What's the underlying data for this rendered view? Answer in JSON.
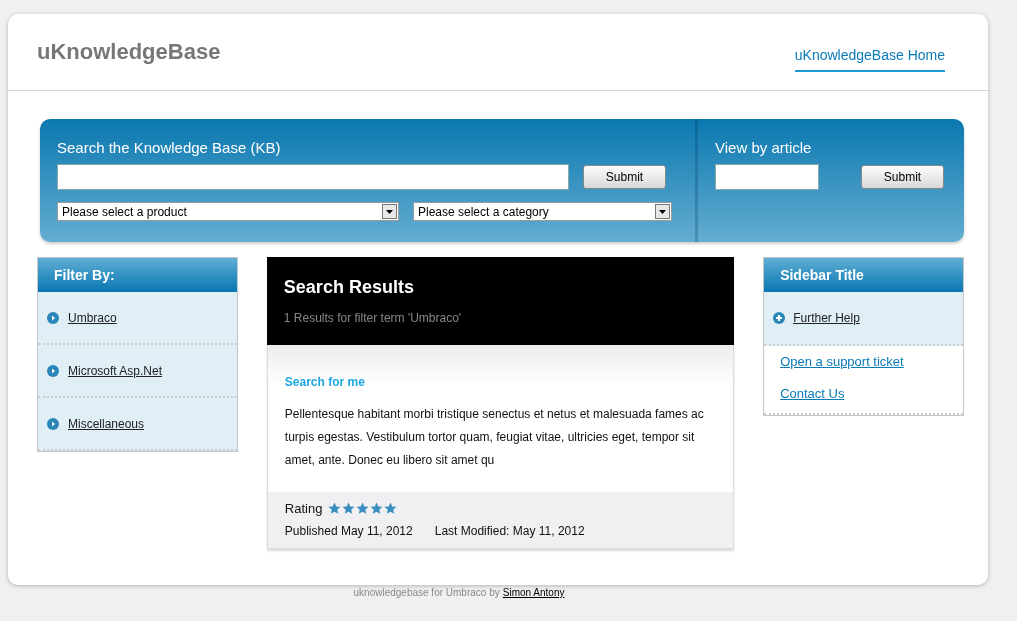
{
  "header": {
    "title": "uKnowledgeBase",
    "nav": [
      {
        "label": "uKnowledgeBase Home",
        "selected": true
      }
    ]
  },
  "search": {
    "title": "Search the Knowledge Base (KB)",
    "button": "Submit",
    "product_select": "Please select a product",
    "category_select": "Please select a category"
  },
  "article_search": {
    "title": "View by article",
    "button": "Submit"
  },
  "filter": {
    "title": "Filter By:",
    "items": [
      {
        "label": "Umbraco"
      },
      {
        "label": "Microsoft Asp.Net"
      },
      {
        "label": "Miscellaneous"
      }
    ]
  },
  "results": {
    "title": "Search Results",
    "subtitle": "1 Results for filter term 'Umbraco'",
    "items": [
      {
        "title": "Search for me",
        "body": "Pellentesque habitant morbi tristique senectus et netus et malesuada fames ac turpis egestas. Vestibulum tortor quam, feugiat vitae, ultricies eget, tempor sit amet, ante. Donec eu libero sit amet qu",
        "rating_label": "Rating",
        "stars": 5,
        "published": "Published May 11, 2012",
        "modified": "Last Modified: May 11, 2012"
      }
    ]
  },
  "sidebar": {
    "title": "Sidebar Title",
    "items": [
      {
        "kind": "expand",
        "label": "Further Help"
      },
      {
        "kind": "link",
        "label": "Open a support ticket"
      },
      {
        "kind": "link",
        "label": "Contact Us"
      }
    ]
  },
  "footer": {
    "text": "uknowledgebase for Umbraco by",
    "link": "Simon Antony"
  }
}
